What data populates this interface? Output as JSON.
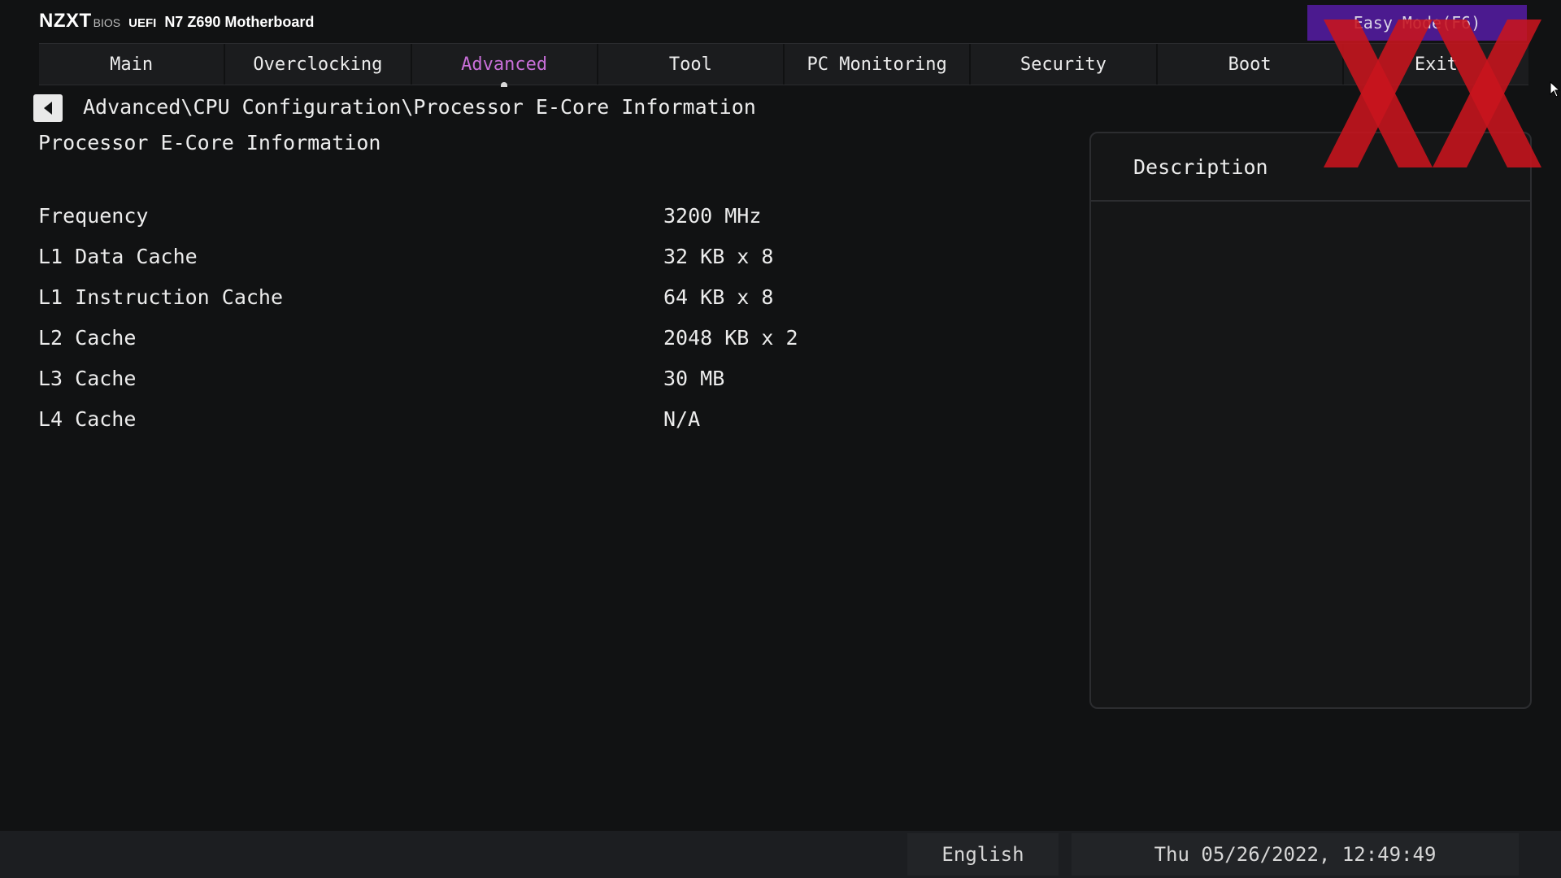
{
  "header": {
    "brand": "NZXT",
    "bios_label": "BIOS",
    "uefi_label": "UEFI",
    "board_name": "N7 Z690 Motherboard",
    "easy_mode_label": "Easy Mode(F6)"
  },
  "tabs": [
    {
      "label": "Main",
      "active": false
    },
    {
      "label": "Overclocking",
      "active": false
    },
    {
      "label": "Advanced",
      "active": true
    },
    {
      "label": "Tool",
      "active": false
    },
    {
      "label": "PC Monitoring",
      "active": false
    },
    {
      "label": "Security",
      "active": false
    },
    {
      "label": "Boot",
      "active": false
    },
    {
      "label": "Exit",
      "active": false
    }
  ],
  "breadcrumb": "Advanced\\CPU Configuration\\Processor E-Core Information",
  "page_title": "Processor E-Core Information",
  "rows": [
    {
      "label": "Frequency",
      "value": "3200 MHz"
    },
    {
      "label": "L1 Data Cache",
      "value": "32 KB x 8"
    },
    {
      "label": "L1 Instruction Cache",
      "value": "64 KB x 8"
    },
    {
      "label": "L2 Cache",
      "value": "2048 KB x 2"
    },
    {
      "label": "L3 Cache",
      "value": "30 MB"
    },
    {
      "label": "L4 Cache",
      "value": "N/A"
    }
  ],
  "description": {
    "title": "Description",
    "text": ""
  },
  "footer": {
    "language": "English",
    "datetime": "Thu 05/26/2022, 12:49:49"
  },
  "colors": {
    "background": "#111213",
    "active_tab": "#c86fd8",
    "easy_mode_bg": "#4b1a8f",
    "watermark": "#c8141e"
  },
  "icons": {
    "back": "chevron-left-icon",
    "watermark": "xx-logo-icon",
    "cursor": "mouse-pointer-icon"
  }
}
